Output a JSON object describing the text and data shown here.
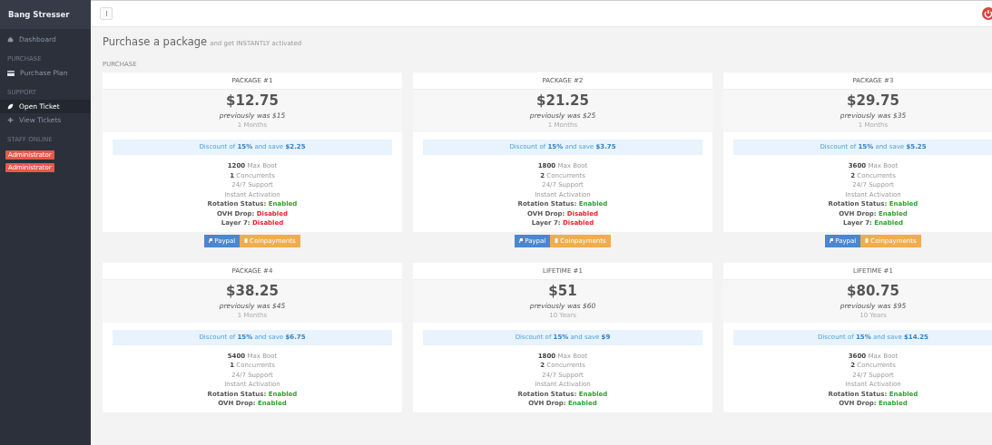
{
  "sidebar": {
    "brand": "Bang Stresser",
    "sections": [
      {
        "items": [
          {
            "label": "Dashboard",
            "selected": false
          }
        ]
      },
      {
        "heading": "PURCHASE",
        "items": [
          {
            "label": "Purchase Plan",
            "selected": false
          }
        ]
      },
      {
        "heading": "SUPPORT",
        "items": [
          {
            "label": "Open Ticket",
            "selected": true
          },
          {
            "label": "View Tickets",
            "selected": false
          }
        ]
      }
    ],
    "staff_heading": "STAFF ONLINE",
    "staff": [
      "Administrator",
      "Administrator"
    ]
  },
  "page": {
    "title": "Purchase a package",
    "subtitle": "and get INSTANTLY activated",
    "section": "PURCHASE"
  },
  "cards": [
    {
      "name": "PACKAGE #1",
      "price": "$12.75",
      "previous": "previously was $15",
      "duration": "1 Months",
      "discount": "Discount of **15%** and save **$2.25**",
      "features": [
        "**1200** Max Boot",
        "**1** Concurrents",
        "24/7 Support",
        "Instant Activation"
      ],
      "statuses": [
        {
          "label": "Rotation Status:",
          "value": "Enabled",
          "enabled": true
        },
        {
          "label": "OVH Drop:",
          "value": "Disabled",
          "enabled": false
        },
        {
          "label": "Layer 7:",
          "value": "Disabled",
          "enabled": false
        }
      ],
      "buttons": [
        "Paypal",
        "Coinpayments"
      ]
    },
    {
      "name": "PACKAGE #2",
      "price": "$21.25",
      "previous": "previously was $25",
      "duration": "1 Months",
      "discount": "Discount of **15%** and save **$3.75**",
      "features": [
        "**1800** Max Boot",
        "**2** Concurrents",
        "24/7 Support",
        "Instant Activation"
      ],
      "statuses": [
        {
          "label": "Rotation Status:",
          "value": "Enabled",
          "enabled": true
        },
        {
          "label": "OVH Drop:",
          "value": "Disabled",
          "enabled": false
        },
        {
          "label": "Layer 7:",
          "value": "Disabled",
          "enabled": false
        }
      ],
      "buttons": [
        "Paypal",
        "Coinpayments"
      ]
    },
    {
      "name": "PACKAGE #3",
      "price": "$29.75",
      "previous": "previously was $35",
      "duration": "1 Months",
      "discount": "Discount of **15%** and save **$5.25**",
      "features": [
        "**3600** Max Boot",
        "**2** Concurrents",
        "24/7 Support",
        "Instant Activation"
      ],
      "statuses": [
        {
          "label": "Rotation Status:",
          "value": "Enabled",
          "enabled": true
        },
        {
          "label": "OVH Drop:",
          "value": "Enabled",
          "enabled": true
        },
        {
          "label": "Layer 7:",
          "value": "Enabled",
          "enabled": true
        }
      ],
      "buttons": [
        "Paypal",
        "Coinpayments"
      ]
    },
    {
      "name": "PACKAGE #4",
      "price": "$38.25",
      "previous": "previously was $45",
      "duration": "1 Months",
      "discount": "Discount of **15%** and save **$6.75**",
      "features": [
        "**5400** Max Boot",
        "**1** Concurrents",
        "24/7 Support",
        "Instant Activation"
      ],
      "statuses": [
        {
          "label": "Rotation Status:",
          "value": "Enabled",
          "enabled": true
        },
        {
          "label": "OVH Drop:",
          "value": "Enabled",
          "enabled": true
        }
      ]
    },
    {
      "name": "LIFETIME #1",
      "price": "$51",
      "previous": "previously was $60",
      "duration": "10 Years",
      "discount": "Discount of **15%** and save **$9**",
      "features": [
        "**1800** Max Boot",
        "**2** Concurrents",
        "24/7 Support",
        "Instant Activation"
      ],
      "statuses": [
        {
          "label": "Rotation Status:",
          "value": "Enabled",
          "enabled": true
        },
        {
          "label": "OVH Drop:",
          "value": "Enabled",
          "enabled": true
        }
      ]
    },
    {
      "name": "LIFETIME #1",
      "price": "$80.75",
      "previous": "previously was $95",
      "duration": "10 Years",
      "discount": "Discount of **15%** and save **$14.25**",
      "features": [
        "**3600** Max Boot",
        "**2** Concurrents",
        "24/7 Support",
        "Instant Activation"
      ],
      "statuses": [
        {
          "label": "Rotation Status:",
          "value": "Enabled",
          "enabled": true
        },
        {
          "label": "OVH Drop:",
          "value": "Enabled",
          "enabled": true
        }
      ]
    }
  ]
}
